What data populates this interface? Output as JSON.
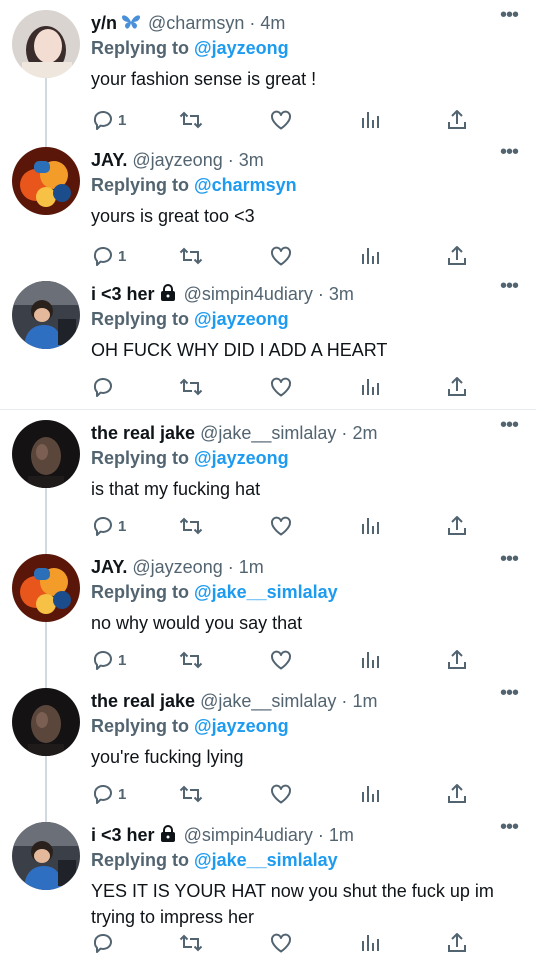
{
  "tweets": [
    {
      "name": "y/n",
      "name_icon": "butterfly-icon",
      "handle": "@charmsyn",
      "dot": "·",
      "time": "4m",
      "replying_to": "Replying to",
      "mention": "@jayzeong",
      "text": "your fashion sense is great !",
      "reply_count": "1",
      "avatar": "avatar-girl-portrait"
    },
    {
      "name": "JAY.",
      "name_icon": "",
      "handle": "@jayzeong",
      "dot": "·",
      "time": "3m",
      "replying_to": "Replying to",
      "mention": "@charmsyn",
      "text": "yours is great too <3",
      "reply_count": "1",
      "avatar": "avatar-fire-orange"
    },
    {
      "name": "i <3 her",
      "name_icon": "lock-icon",
      "handle": "@simpin4udiary",
      "dot": "·",
      "time": "3m",
      "replying_to": "Replying to",
      "mention": "@jayzeong",
      "text": "OH FUCK WHY DID I ADD A HEART",
      "reply_count": "",
      "avatar": "avatar-boy-blue"
    },
    {
      "name": "the real jake",
      "name_icon": "",
      "handle": "@jake__simlalay",
      "dot": "·",
      "time": "2m",
      "replying_to": "Replying to",
      "mention": "@jayzeong",
      "text": "is that my fucking hat",
      "reply_count": "1",
      "avatar": "avatar-dark-portrait"
    },
    {
      "name": "JAY.",
      "name_icon": "",
      "handle": "@jayzeong",
      "dot": "·",
      "time": "1m",
      "replying_to": "Replying to",
      "mention": "@jake__simlalay",
      "text": "no why would you say that",
      "reply_count": "1",
      "avatar": "avatar-fire-orange"
    },
    {
      "name": "the real jake",
      "name_icon": "",
      "handle": "@jake__simlalay",
      "dot": "·",
      "time": "1m",
      "replying_to": "Replying to",
      "mention": "@jayzeong",
      "text": "you're fucking lying",
      "reply_count": "1",
      "avatar": "avatar-dark-portrait"
    },
    {
      "name": "i <3 her",
      "name_icon": "lock-icon",
      "handle": "@simpin4udiary",
      "dot": "·",
      "time": "1m",
      "replying_to": "Replying to",
      "mention": "@jake__simlalay",
      "text": "YES IT IS YOUR HAT now you shut the fuck up im trying to impress her",
      "reply_count": "",
      "avatar": "avatar-boy-blue"
    }
  ],
  "more_label": "•••",
  "colors": {
    "mention": "#1d9bf0",
    "muted": "#536471",
    "text": "#0f1419",
    "divider": "#e6ecf0"
  }
}
